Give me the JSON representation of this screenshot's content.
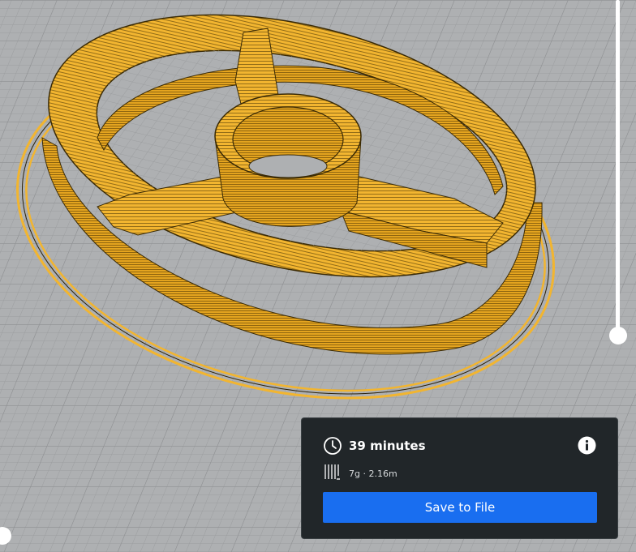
{
  "app": {
    "accent_color": "#196ef0",
    "panel_bg_color": "#212629",
    "model_color": "#f2b530",
    "plate_color": "#a9abad"
  },
  "print_info": {
    "time_icon": "clock-icon",
    "time_estimate": "39 minutes",
    "info_icon": "info-icon",
    "material_icon": "filament-icon",
    "material_estimate": "7g · 2.16m",
    "save_label": "Save to File"
  },
  "layer_slider": {
    "handle_position_fraction": 0.0
  }
}
